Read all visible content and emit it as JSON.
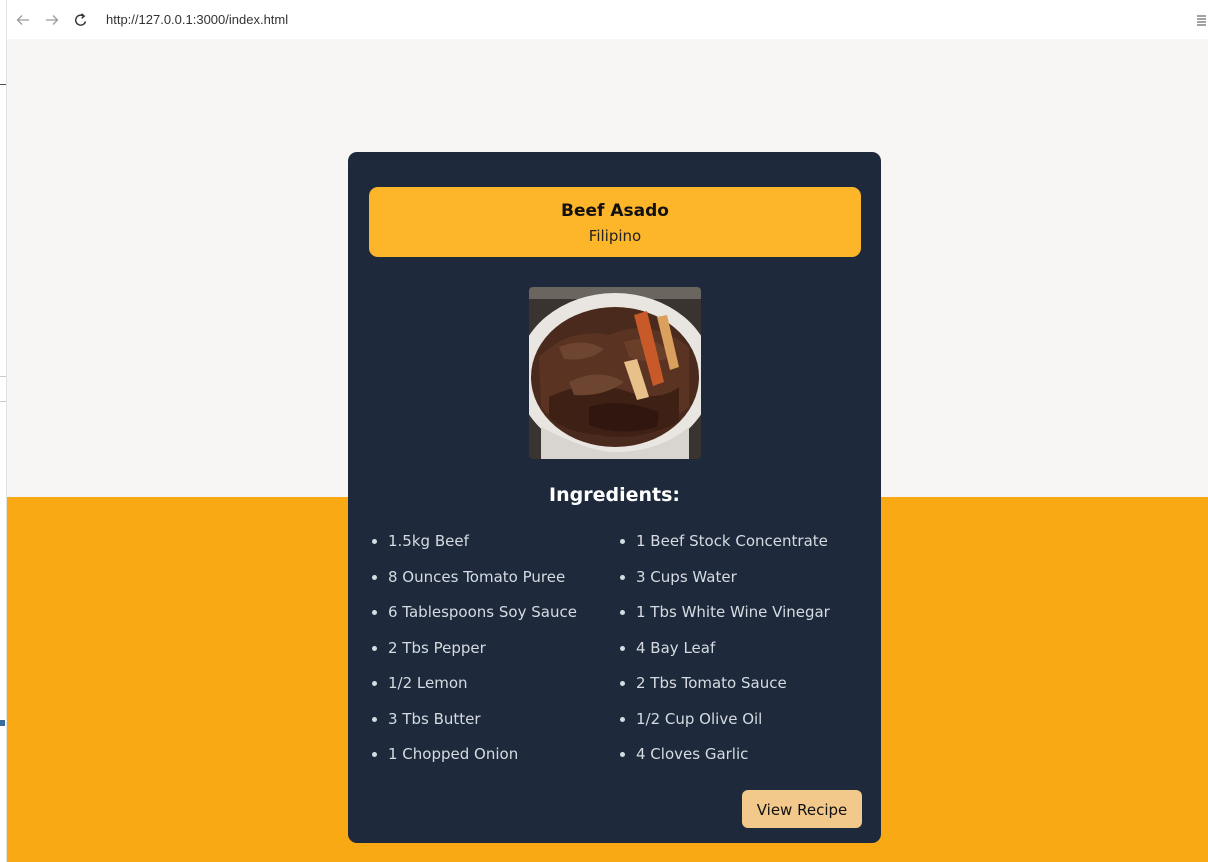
{
  "browser": {
    "url": "http://127.0.0.1:3000/index.html",
    "back_icon": "arrow-left-icon",
    "forward_icon": "arrow-right-icon",
    "reload_icon": "reload-icon",
    "menu_icon": "hamburger-menu-icon"
  },
  "colors": {
    "page_background": "#f7f6f4",
    "band": "#f8a913",
    "card": "#1e293b",
    "header": "#fdb52a",
    "button": "#f2c98a"
  },
  "recipe": {
    "title": "Beef Asado",
    "cuisine": "Filipino",
    "ingredients_heading": "Ingredients:",
    "ingredients_left": [
      "1.5kg Beef",
      "8 Ounces Tomato Puree",
      "6 Tablespoons Soy Sauce",
      "2 Tbs Pepper",
      "1/2 Lemon",
      "3 Tbs Butter",
      "1 Chopped Onion"
    ],
    "ingredients_right": [
      "1 Beef Stock Concentrate",
      "3 Cups Water",
      "1 Tbs White Wine Vinegar",
      "4 Bay Leaf",
      "2 Tbs Tomato Sauce",
      "1/2 Cup Olive Oil",
      "4 Cloves Garlic"
    ],
    "button_label": "View Recipe"
  }
}
